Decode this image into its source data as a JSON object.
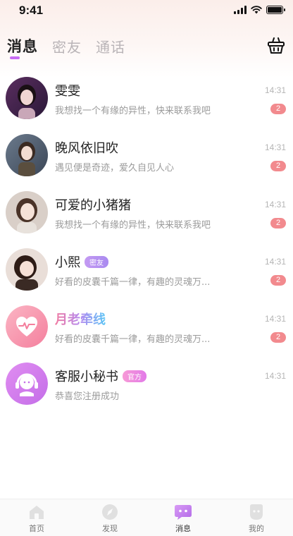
{
  "status_bar": {
    "time": "9:41"
  },
  "tabs": [
    {
      "label": "消息",
      "active": true
    },
    {
      "label": "密友",
      "active": false
    },
    {
      "label": "通话",
      "active": false
    }
  ],
  "conversations": [
    {
      "name": "雯雯",
      "tag": "",
      "time": "14:31",
      "preview": "我想找一个有缘的异性，快来联系我吧",
      "unread": "2"
    },
    {
      "name": "晚风依旧吹",
      "tag": "",
      "time": "14:31",
      "preview": "遇见便是奇迹，爱久自见人心",
      "unread": "2"
    },
    {
      "name": "可爱的小猪猪",
      "tag": "",
      "time": "14:31",
      "preview": "我想找一个有缘的异性，快来联系我吧",
      "unread": "2"
    },
    {
      "name": "小熙",
      "tag": "密友",
      "time": "14:31",
      "preview": "好看的皮囊千篇一律，有趣的灵魂万...",
      "unread": "2"
    },
    {
      "name": "月老牵线",
      "tag": "",
      "time": "14:31",
      "preview": "好看的皮囊千篇一律，有趣的灵魂万...",
      "unread": "2"
    },
    {
      "name": "客服小秘书",
      "tag": "官方",
      "time": "14:31",
      "preview": "恭喜您注册成功",
      "unread": ""
    }
  ],
  "bottom_nav": [
    {
      "label": "首页",
      "icon": "home-icon"
    },
    {
      "label": "发现",
      "icon": "discover-icon"
    },
    {
      "label": "消息",
      "icon": "message-icon",
      "active": true
    },
    {
      "label": "我的",
      "icon": "profile-icon"
    }
  ],
  "colors": {
    "accent": "#c86cf3",
    "badge": "#f28a8e",
    "tag": "#b48af0"
  }
}
